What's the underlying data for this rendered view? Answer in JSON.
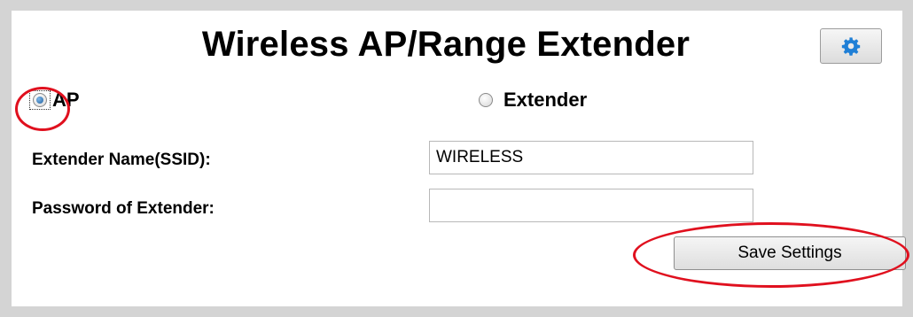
{
  "page": {
    "title": "Wireless AP/Range Extender"
  },
  "settings_button": {
    "icon": "gear-icon",
    "icon_color": "#1f7fd6"
  },
  "mode": {
    "options": [
      {
        "label": "AP",
        "checked": true
      },
      {
        "label": "Extender",
        "checked": false
      }
    ]
  },
  "form": {
    "ssid_label": "Extender Name(SSID):",
    "ssid_value": "WIRELESS",
    "password_label": "Password of Extender:",
    "password_value": ""
  },
  "save_button": {
    "label": "Save Settings"
  },
  "annotation_color": "#e0101e"
}
